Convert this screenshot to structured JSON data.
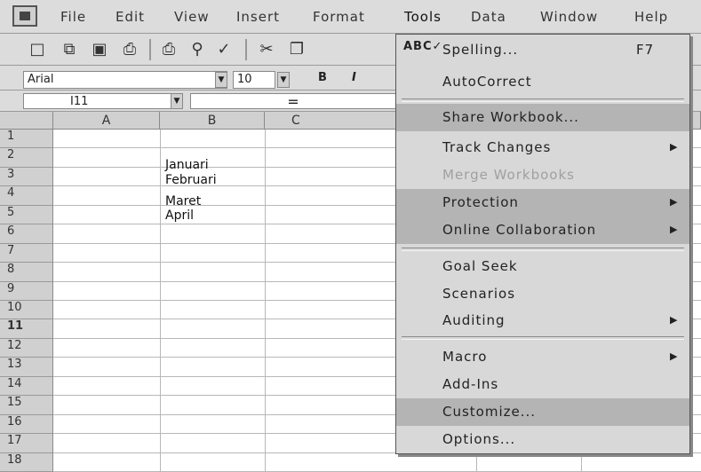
{
  "menubar": {
    "items": [
      "File",
      "Edit",
      "View",
      "Insert",
      "Format",
      "Tools",
      "Data",
      "Window",
      "Help"
    ]
  },
  "toolbar": {
    "icons": [
      "new-icon",
      "open-icon",
      "save-icon",
      "print-icon",
      "print-preview-icon",
      "spelling-icon",
      "cut-icon",
      "copy-icon"
    ]
  },
  "format": {
    "font": "Arial",
    "size": "10",
    "bold_label": "B",
    "italic_label": "I"
  },
  "formula": {
    "name_box": "I11",
    "equals": "="
  },
  "sheet": {
    "columns": [
      "A",
      "B",
      "C"
    ],
    "rows": [
      "1",
      "2",
      "3",
      "4",
      "5",
      "6",
      "7",
      "8",
      "9",
      "10",
      "11",
      "12",
      "13",
      "14",
      "15",
      "16",
      "17",
      "18"
    ],
    "selected_row": "11",
    "cells": [
      "Januari",
      "Februari",
      "Maret",
      "April"
    ]
  },
  "tools_menu": {
    "items": [
      {
        "label": "Spelling...",
        "shortcut": "F7",
        "icon": "spelling-icon"
      },
      {
        "label": "AutoCorrect"
      },
      {
        "label": "Share Workbook..."
      },
      {
        "label": "Track Changes",
        "submenu": true
      },
      {
        "label": "Merge Workbooks",
        "disabled": true
      },
      {
        "label": "Protection",
        "submenu": true
      },
      {
        "label": "Online Collaboration",
        "submenu": true
      },
      {
        "label": "Goal Seek"
      },
      {
        "label": "Scenarios"
      },
      {
        "label": "Auditing",
        "submenu": true
      },
      {
        "label": "Macro",
        "submenu": true
      },
      {
        "label": "Add-Ins"
      },
      {
        "label": "Customize..."
      },
      {
        "label": "Options..."
      }
    ]
  },
  "colors": {
    "chrome": "#dcdcdc",
    "menu_highlight": "#b4b4b4",
    "disabled_text": "#a0a0a0"
  }
}
